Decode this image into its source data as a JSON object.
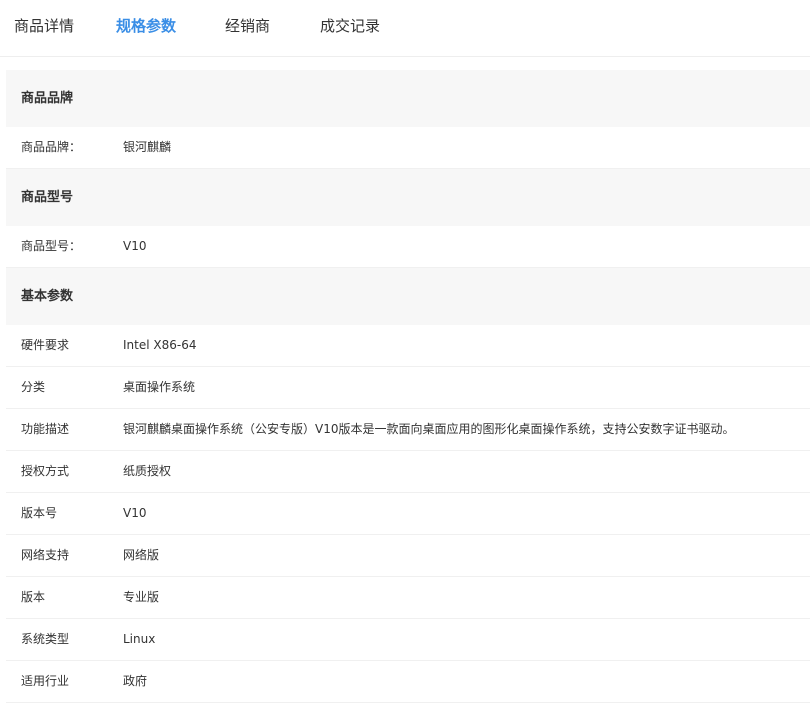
{
  "tabs": [
    {
      "label": "商品详情",
      "active": false
    },
    {
      "label": "规格参数",
      "active": true
    },
    {
      "label": "经销商",
      "active": false
    },
    {
      "label": "成交记录",
      "active": false
    }
  ],
  "accent_color": "#3a8ee6",
  "sections": [
    {
      "title": "商品品牌",
      "rows": [
        {
          "label": "商品品牌：",
          "value": "银河麒麟"
        }
      ]
    },
    {
      "title": "商品型号",
      "rows": [
        {
          "label": "商品型号：",
          "value": "V10"
        }
      ]
    },
    {
      "title": "基本参数",
      "rows": [
        {
          "label": "硬件要求",
          "value": "Intel X86-64"
        },
        {
          "label": "分类",
          "value": "桌面操作系统"
        },
        {
          "label": "功能描述",
          "value": "银河麒麟桌面操作系统（公安专版）V10版本是一款面向桌面应用的图形化桌面操作系统，支持公安数字证书驱动。"
        },
        {
          "label": "授权方式",
          "value": "纸质授权"
        },
        {
          "label": "版本号",
          "value": "V10"
        },
        {
          "label": "网络支持",
          "value": "网络版"
        },
        {
          "label": "版本",
          "value": "专业版"
        },
        {
          "label": "系统类型",
          "value": "Linux"
        },
        {
          "label": "适用行业",
          "value": "政府"
        }
      ]
    }
  ]
}
